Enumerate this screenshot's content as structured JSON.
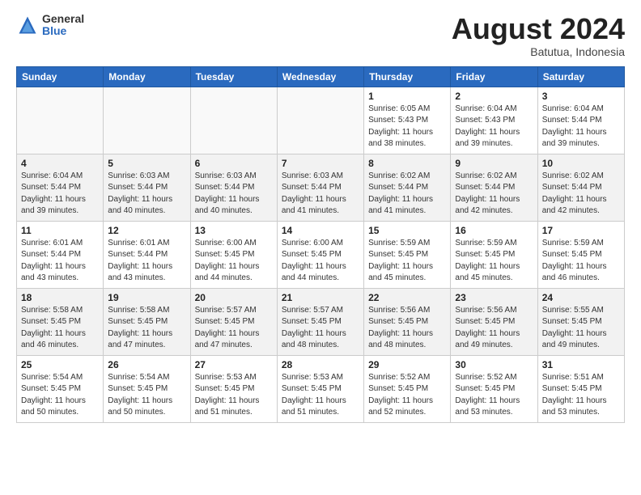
{
  "header": {
    "logo_general": "General",
    "logo_blue": "Blue",
    "month_year": "August 2024",
    "location": "Batutua, Indonesia"
  },
  "days_of_week": [
    "Sunday",
    "Monday",
    "Tuesday",
    "Wednesday",
    "Thursday",
    "Friday",
    "Saturday"
  ],
  "weeks": [
    [
      {
        "day": "",
        "info": ""
      },
      {
        "day": "",
        "info": ""
      },
      {
        "day": "",
        "info": ""
      },
      {
        "day": "",
        "info": ""
      },
      {
        "day": "1",
        "info": "Sunrise: 6:05 AM\nSunset: 5:43 PM\nDaylight: 11 hours\nand 38 minutes."
      },
      {
        "day": "2",
        "info": "Sunrise: 6:04 AM\nSunset: 5:43 PM\nDaylight: 11 hours\nand 39 minutes."
      },
      {
        "day": "3",
        "info": "Sunrise: 6:04 AM\nSunset: 5:44 PM\nDaylight: 11 hours\nand 39 minutes."
      }
    ],
    [
      {
        "day": "4",
        "info": "Sunrise: 6:04 AM\nSunset: 5:44 PM\nDaylight: 11 hours\nand 39 minutes."
      },
      {
        "day": "5",
        "info": "Sunrise: 6:03 AM\nSunset: 5:44 PM\nDaylight: 11 hours\nand 40 minutes."
      },
      {
        "day": "6",
        "info": "Sunrise: 6:03 AM\nSunset: 5:44 PM\nDaylight: 11 hours\nand 40 minutes."
      },
      {
        "day": "7",
        "info": "Sunrise: 6:03 AM\nSunset: 5:44 PM\nDaylight: 11 hours\nand 41 minutes."
      },
      {
        "day": "8",
        "info": "Sunrise: 6:02 AM\nSunset: 5:44 PM\nDaylight: 11 hours\nand 41 minutes."
      },
      {
        "day": "9",
        "info": "Sunrise: 6:02 AM\nSunset: 5:44 PM\nDaylight: 11 hours\nand 42 minutes."
      },
      {
        "day": "10",
        "info": "Sunrise: 6:02 AM\nSunset: 5:44 PM\nDaylight: 11 hours\nand 42 minutes."
      }
    ],
    [
      {
        "day": "11",
        "info": "Sunrise: 6:01 AM\nSunset: 5:44 PM\nDaylight: 11 hours\nand 43 minutes."
      },
      {
        "day": "12",
        "info": "Sunrise: 6:01 AM\nSunset: 5:44 PM\nDaylight: 11 hours\nand 43 minutes."
      },
      {
        "day": "13",
        "info": "Sunrise: 6:00 AM\nSunset: 5:45 PM\nDaylight: 11 hours\nand 44 minutes."
      },
      {
        "day": "14",
        "info": "Sunrise: 6:00 AM\nSunset: 5:45 PM\nDaylight: 11 hours\nand 44 minutes."
      },
      {
        "day": "15",
        "info": "Sunrise: 5:59 AM\nSunset: 5:45 PM\nDaylight: 11 hours\nand 45 minutes."
      },
      {
        "day": "16",
        "info": "Sunrise: 5:59 AM\nSunset: 5:45 PM\nDaylight: 11 hours\nand 45 minutes."
      },
      {
        "day": "17",
        "info": "Sunrise: 5:59 AM\nSunset: 5:45 PM\nDaylight: 11 hours\nand 46 minutes."
      }
    ],
    [
      {
        "day": "18",
        "info": "Sunrise: 5:58 AM\nSunset: 5:45 PM\nDaylight: 11 hours\nand 46 minutes."
      },
      {
        "day": "19",
        "info": "Sunrise: 5:58 AM\nSunset: 5:45 PM\nDaylight: 11 hours\nand 47 minutes."
      },
      {
        "day": "20",
        "info": "Sunrise: 5:57 AM\nSunset: 5:45 PM\nDaylight: 11 hours\nand 47 minutes."
      },
      {
        "day": "21",
        "info": "Sunrise: 5:57 AM\nSunset: 5:45 PM\nDaylight: 11 hours\nand 48 minutes."
      },
      {
        "day": "22",
        "info": "Sunrise: 5:56 AM\nSunset: 5:45 PM\nDaylight: 11 hours\nand 48 minutes."
      },
      {
        "day": "23",
        "info": "Sunrise: 5:56 AM\nSunset: 5:45 PM\nDaylight: 11 hours\nand 49 minutes."
      },
      {
        "day": "24",
        "info": "Sunrise: 5:55 AM\nSunset: 5:45 PM\nDaylight: 11 hours\nand 49 minutes."
      }
    ],
    [
      {
        "day": "25",
        "info": "Sunrise: 5:54 AM\nSunset: 5:45 PM\nDaylight: 11 hours\nand 50 minutes."
      },
      {
        "day": "26",
        "info": "Sunrise: 5:54 AM\nSunset: 5:45 PM\nDaylight: 11 hours\nand 50 minutes."
      },
      {
        "day": "27",
        "info": "Sunrise: 5:53 AM\nSunset: 5:45 PM\nDaylight: 11 hours\nand 51 minutes."
      },
      {
        "day": "28",
        "info": "Sunrise: 5:53 AM\nSunset: 5:45 PM\nDaylight: 11 hours\nand 51 minutes."
      },
      {
        "day": "29",
        "info": "Sunrise: 5:52 AM\nSunset: 5:45 PM\nDaylight: 11 hours\nand 52 minutes."
      },
      {
        "day": "30",
        "info": "Sunrise: 5:52 AM\nSunset: 5:45 PM\nDaylight: 11 hours\nand 53 minutes."
      },
      {
        "day": "31",
        "info": "Sunrise: 5:51 AM\nSunset: 5:45 PM\nDaylight: 11 hours\nand 53 minutes."
      }
    ]
  ]
}
